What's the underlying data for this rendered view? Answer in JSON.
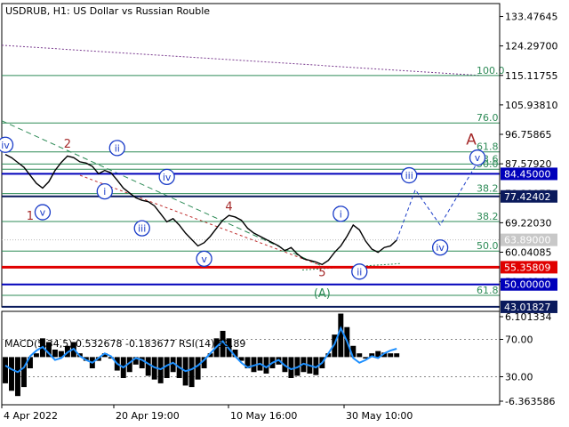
{
  "chart_data": {
    "type": "line",
    "title": "USDRUB, H1:  US Dollar vs Russian Rouble",
    "y_ticks": [
      "133.47645",
      "124.29700",
      "115.11755",
      "105.93810",
      "96.75865",
      "87.57920",
      "78.39975",
      "69.22030",
      "60.04085",
      "50.86140"
    ],
    "x_ticks": [
      "4 Apr 2022",
      "20 Apr 19:00",
      "10 May 16:00",
      "30 May 10:00"
    ],
    "ylim": [
      43.0,
      137.5
    ],
    "price": [
      90.5,
      89.5,
      88.0,
      86.5,
      84.0,
      81.5,
      80.0,
      82.0,
      85.5,
      88.0,
      90.0,
      89.5,
      88.2,
      87.8,
      86.8,
      84.5,
      85.5,
      84.8,
      82.5,
      80.0,
      78.5,
      77.0,
      76.2,
      75.8,
      74.5,
      72.0,
      69.5,
      70.5,
      68.5,
      66.0,
      64.0,
      62.0,
      63.0,
      65.0,
      67.5,
      70.0,
      71.5,
      71.0,
      70.0,
      67.5,
      66.0,
      65.0,
      64.0,
      63.0,
      62.0,
      60.5,
      61.5,
      59.5,
      58.0,
      57.5,
      57.0,
      56.2,
      57.5,
      60.0,
      62.0,
      65.0,
      68.5,
      67.0,
      63.5,
      61.0,
      60.0,
      61.5,
      62.0,
      63.8
    ],
    "tags": [
      {
        "text": "84.45000",
        "value": 84.45,
        "color": "#0000bb"
      },
      {
        "text": "77.42402",
        "value": 77.424,
        "color": "#0a1a5c"
      },
      {
        "text": "63.89000",
        "value": 63.89,
        "color": "#c8c8c8"
      },
      {
        "text": "55.35809",
        "value": 55.358,
        "color": "#e00000"
      },
      {
        "text": "50.00000",
        "value": 50.0,
        "color": "#0000bb"
      },
      {
        "text": "43.01827",
        "value": 43.018,
        "color": "#0a1a5c"
      }
    ],
    "fib_levels": [
      {
        "text": "100.0",
        "value": 115.1
      },
      {
        "text": "76.0",
        "value": 100.3
      },
      {
        "text": "61.8",
        "value": 91.3
      },
      {
        "text": "23.6",
        "value": 87.5
      },
      {
        "text": "50.0",
        "value": 85.9
      },
      {
        "text": "38.2",
        "value": 78.3
      },
      {
        "text": "38.2",
        "value": 69.6
      },
      {
        "text": "50.0",
        "value": 60.4
      },
      {
        "text": "61.8",
        "value": 46.6
      }
    ],
    "wave_labels": [
      {
        "text": "1",
        "index": 4,
        "value": 71.5,
        "color": "#a52a2a",
        "circled": false
      },
      {
        "text": "2",
        "index": 10,
        "value": 94.0,
        "color": "#a52a2a",
        "circled": false
      },
      {
        "text": "4",
        "index": 36,
        "value": 74.5,
        "color": "#a52a2a",
        "circled": false
      },
      {
        "text": "5",
        "index": 51,
        "value": 54.0,
        "color": "#a52a2a",
        "circled": false
      },
      {
        "text": "A",
        "index": 75,
        "value": 95.0,
        "color": "#a52a2a",
        "circled": false
      },
      {
        "text": "(A)",
        "index": 51,
        "value": 47.5,
        "color": "#2e8b57",
        "circled": false
      },
      {
        "text": "iv",
        "index": 0,
        "value": 93.5,
        "color": "#1a3cc8",
        "circled": true
      },
      {
        "text": "v",
        "index": 6,
        "value": 72.5,
        "color": "#1a3cc8",
        "circled": true
      },
      {
        "text": "i",
        "index": 16,
        "value": 79.0,
        "color": "#1a3cc8",
        "circled": true
      },
      {
        "text": "ii",
        "index": 18,
        "value": 92.5,
        "color": "#1a3cc8",
        "circled": true
      },
      {
        "text": "iii",
        "index": 22,
        "value": 67.5,
        "color": "#1a3cc8",
        "circled": true
      },
      {
        "text": "iv",
        "index": 26,
        "value": 83.5,
        "color": "#1a3cc8",
        "circled": true
      },
      {
        "text": "v",
        "index": 32,
        "value": 58.0,
        "color": "#1a3cc8",
        "circled": true
      },
      {
        "text": "i",
        "index": 54,
        "value": 72.0,
        "color": "#1a3cc8",
        "circled": true
      },
      {
        "text": "ii",
        "index": 57,
        "value": 54.0,
        "color": "#1a3cc8",
        "circled": true
      },
      {
        "text": "iii",
        "index": 65,
        "value": 84.0,
        "color": "#1a3cc8",
        "circled": true
      },
      {
        "text": "iv",
        "index": 70,
        "value": 61.5,
        "color": "#1a3cc8",
        "circled": true
      },
      {
        "text": "v",
        "index": 76,
        "value": 89.5,
        "color": "#1a3cc8",
        "circled": true
      }
    ],
    "forecast": {
      "index": [
        63,
        66,
        70,
        76
      ],
      "value": [
        63.8,
        79.5,
        68.5,
        88.0
      ]
    },
    "indicator": {
      "label": "MACD(5,34,5) 0.532678 -0.183677 RSI(14) 59.89",
      "y_ticks": [
        "6.101334",
        "70.00",
        "30.00",
        "-6.363586"
      ],
      "levels": [
        70,
        30
      ],
      "rsi": [
        42,
        38,
        35,
        40,
        52,
        58,
        62,
        55,
        48,
        50,
        56,
        60,
        52,
        48,
        45,
        50,
        55,
        52,
        44,
        40,
        45,
        50,
        48,
        44,
        40,
        38,
        42,
        45,
        40,
        36,
        38,
        42,
        48,
        55,
        62,
        68,
        60,
        52,
        45,
        40,
        42,
        44,
        40,
        45,
        48,
        42,
        38,
        40,
        44,
        42,
        40,
        45,
        55,
        65,
        82,
        68,
        50,
        45,
        48,
        52,
        50,
        55,
        58,
        60
      ],
      "macd": [
        -3.5,
        -4.5,
        -5.2,
        -4.0,
        -1.5,
        0.5,
        2.5,
        2.0,
        1.0,
        0.8,
        1.5,
        2.0,
        0.5,
        -0.5,
        -1.5,
        -0.5,
        0.5,
        -0.2,
        -1.8,
        -2.8,
        -2.0,
        -1.0,
        -1.5,
        -2.5,
        -3.0,
        -3.5,
        -2.8,
        -2.0,
        -2.8,
        -3.8,
        -4.0,
        -3.0,
        -1.5,
        0.5,
        2.5,
        3.5,
        2.5,
        1.0,
        -0.5,
        -1.5,
        -2.0,
        -1.8,
        -2.2,
        -1.5,
        -1.0,
        -2.0,
        -2.8,
        -2.5,
        -2.0,
        -2.2,
        -2.4,
        -1.5,
        0.5,
        3.0,
        5.8,
        4.0,
        1.5,
        0.5,
        -0.2,
        0.5,
        0.8,
        0.6,
        0.5,
        0.5
      ]
    }
  }
}
